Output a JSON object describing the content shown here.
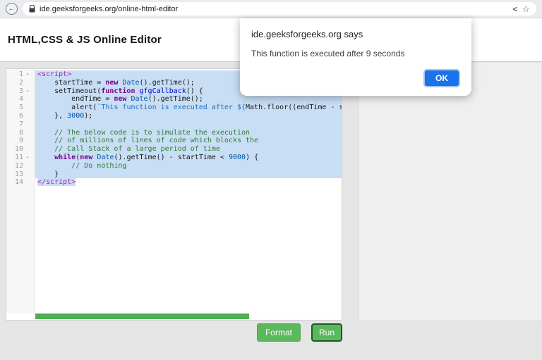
{
  "browser": {
    "url": "ide.geeksforgeeks.org/online-html-editor"
  },
  "header": {
    "title": "HTML,CSS & JS Online Editor"
  },
  "dialog": {
    "title": "ide.geeksforgeeks.org says",
    "message": "This function is executed after 9 seconds",
    "ok_label": "OK"
  },
  "buttons": {
    "format": "Format",
    "run": "Run"
  },
  "colors": {
    "button_green": "#5cb85c",
    "ok_button_blue": "#1a73e8",
    "selection_blue": "#c8def5",
    "progress_green": "#4caf50"
  },
  "editor": {
    "lines": [
      {
        "n": 1,
        "fold": true,
        "sel": "full",
        "toks": [
          [
            "tag",
            "<script>"
          ]
        ]
      },
      {
        "n": 2,
        "fold": false,
        "sel": "full",
        "toks": [
          [
            "pln",
            "    startTime = "
          ],
          [
            "kw",
            "new"
          ],
          [
            "pln",
            " "
          ],
          [
            "type",
            "Date"
          ],
          [
            "pln",
            "().getTime();"
          ]
        ]
      },
      {
        "n": 3,
        "fold": true,
        "sel": "full",
        "toks": [
          [
            "pln",
            "    setTimeout("
          ],
          [
            "kw",
            "function"
          ],
          [
            "pln",
            " "
          ],
          [
            "def",
            "gfgCallback"
          ],
          [
            "pln",
            "() {"
          ]
        ]
      },
      {
        "n": 4,
        "fold": false,
        "sel": "full",
        "toks": [
          [
            "pln",
            "        endTime = "
          ],
          [
            "kw",
            "new"
          ],
          [
            "pln",
            " "
          ],
          [
            "type",
            "Date"
          ],
          [
            "pln",
            "().getTime();"
          ]
        ]
      },
      {
        "n": 5,
        "fold": false,
        "sel": "full",
        "toks": [
          [
            "pln",
            "        alert("
          ],
          [
            "str",
            "`This function is executed after ${"
          ],
          [
            "pln",
            "Math.floor((endTime - sta"
          ]
        ]
      },
      {
        "n": 6,
        "fold": false,
        "sel": "full",
        "toks": [
          [
            "pln",
            "    }, "
          ],
          [
            "num",
            "3000"
          ],
          [
            "pln",
            ");"
          ]
        ]
      },
      {
        "n": 7,
        "fold": false,
        "sel": "full",
        "toks": [
          [
            "pln",
            " "
          ]
        ]
      },
      {
        "n": 8,
        "fold": false,
        "sel": "full",
        "toks": [
          [
            "pln",
            "    "
          ],
          [
            "com",
            "// The below code is to simulate the execution"
          ]
        ]
      },
      {
        "n": 9,
        "fold": false,
        "sel": "full",
        "toks": [
          [
            "pln",
            "    "
          ],
          [
            "com",
            "// of millions of lines of code which blocks the"
          ]
        ]
      },
      {
        "n": 10,
        "fold": false,
        "sel": "full",
        "toks": [
          [
            "pln",
            "    "
          ],
          [
            "com",
            "// Call Stack of a large period of time"
          ]
        ]
      },
      {
        "n": 11,
        "fold": true,
        "sel": "full",
        "toks": [
          [
            "pln",
            "    "
          ],
          [
            "kw",
            "while"
          ],
          [
            "pln",
            "("
          ],
          [
            "kw",
            "new"
          ],
          [
            "pln",
            " "
          ],
          [
            "type",
            "Date"
          ],
          [
            "pln",
            "().getTime() - startTime < "
          ],
          [
            "num",
            "9000"
          ],
          [
            "pln",
            ") {"
          ]
        ]
      },
      {
        "n": 12,
        "fold": false,
        "sel": "full",
        "toks": [
          [
            "pln",
            "        "
          ],
          [
            "com",
            "// Do nothing"
          ]
        ]
      },
      {
        "n": 13,
        "fold": false,
        "sel": "full",
        "toks": [
          [
            "pln",
            "    }"
          ]
        ]
      },
      {
        "n": 14,
        "fold": false,
        "sel": "text",
        "toks": [
          [
            "tag",
            "</script>"
          ]
        ]
      }
    ]
  }
}
